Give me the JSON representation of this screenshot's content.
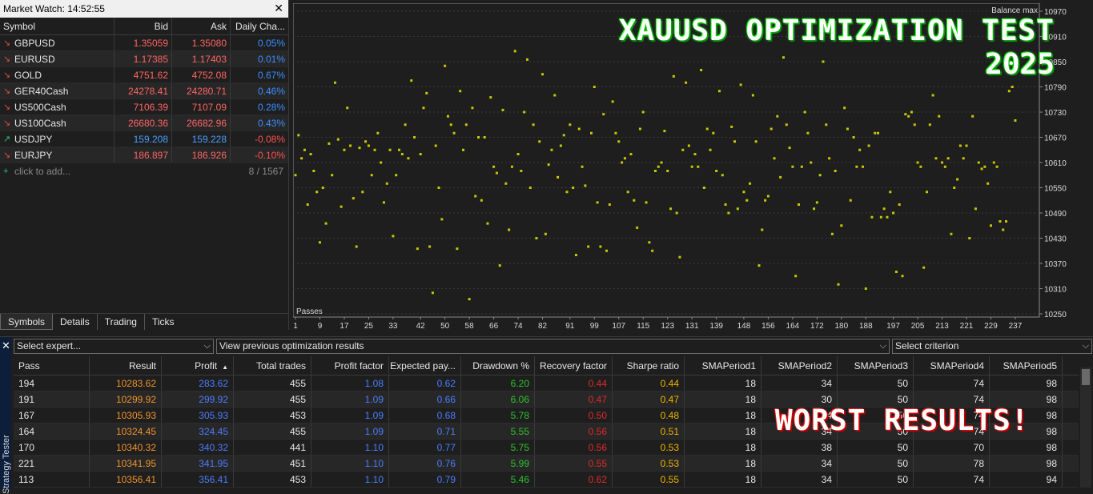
{
  "market_watch": {
    "title": "Market Watch: 14:52:55",
    "columns": [
      "Symbol",
      "Bid",
      "Ask",
      "Daily Cha..."
    ],
    "rows": [
      {
        "symbol": "GBPUSD",
        "bid": "1.35059",
        "ask": "1.35080",
        "change": "0.05%",
        "dir": "down",
        "change_sign": "pos"
      },
      {
        "symbol": "EURUSD",
        "bid": "1.17385",
        "ask": "1.17403",
        "change": "0.01%",
        "dir": "down",
        "change_sign": "pos"
      },
      {
        "symbol": "GOLD",
        "bid": "4751.62",
        "ask": "4752.08",
        "change": "0.67%",
        "dir": "down",
        "change_sign": "pos"
      },
      {
        "symbol": "GER40Cash",
        "bid": "24278.41",
        "ask": "24280.71",
        "change": "0.46%",
        "dir": "down",
        "change_sign": "pos"
      },
      {
        "symbol": "US500Cash",
        "bid": "7106.39",
        "ask": "7107.09",
        "change": "0.28%",
        "dir": "down",
        "change_sign": "pos"
      },
      {
        "symbol": "US100Cash",
        "bid": "26680.36",
        "ask": "26682.96",
        "change": "0.43%",
        "dir": "down",
        "change_sign": "pos"
      },
      {
        "symbol": "USDJPY",
        "bid": "159.208",
        "ask": "159.228",
        "change": "-0.08%",
        "dir": "up",
        "change_sign": "neg"
      },
      {
        "symbol": "EURJPY",
        "bid": "186.897",
        "ask": "186.926",
        "change": "-0.10%",
        "dir": "down",
        "change_sign": "neg"
      }
    ],
    "add_label": "click to add...",
    "count": "8 / 1567",
    "tabs": [
      "Symbols",
      "Details",
      "Trading",
      "Ticks"
    ]
  },
  "chart_data": {
    "type": "scatter",
    "title": "XAUUSD OPTIMIZATION TEST",
    "subtitle": "2025",
    "ylabel": "Balance max",
    "xlabel": "Passes",
    "ylim": [
      10250,
      10980
    ],
    "y_ticks": [
      "10970",
      "10910",
      "10850",
      "10790",
      "10730",
      "10670",
      "10610",
      "10550",
      "10490",
      "10430",
      "10370",
      "10310",
      "10250"
    ],
    "x_ticks": [
      "1",
      "9",
      "17",
      "25",
      "33",
      "42",
      "50",
      "58",
      "66",
      "74",
      "82",
      "91",
      "99",
      "107",
      "115",
      "123",
      "131",
      "139",
      "148",
      "156",
      "164",
      "172",
      "180",
      "188",
      "197",
      "205",
      "213",
      "221",
      "229",
      "237"
    ],
    "x_range": [
      1,
      242
    ],
    "points": [
      [
        1,
        10580
      ],
      [
        2,
        10675
      ],
      [
        3,
        10620
      ],
      [
        4,
        10640
      ],
      [
        5,
        10510
      ],
      [
        6,
        10630
      ],
      [
        7,
        10590
      ],
      [
        8,
        10540
      ],
      [
        9,
        10420
      ],
      [
        10,
        10550
      ],
      [
        11,
        10465
      ],
      [
        12,
        10655
      ],
      [
        13,
        10580
      ],
      [
        14,
        10800
      ],
      [
        15,
        10665
      ],
      [
        16,
        10505
      ],
      [
        17,
        10640
      ],
      [
        18,
        10740
      ],
      [
        19,
        10650
      ],
      [
        20,
        10525
      ],
      [
        21,
        10410
      ],
      [
        22,
        10645
      ],
      [
        23,
        10540
      ],
      [
        24,
        10660
      ],
      [
        25,
        10650
      ],
      [
        26,
        10580
      ],
      [
        27,
        10640
      ],
      [
        28,
        10680
      ],
      [
        29,
        10610
      ],
      [
        30,
        10515
      ],
      [
        31,
        10560
      ],
      [
        32,
        10640
      ],
      [
        33,
        10435
      ],
      [
        34,
        10580
      ],
      [
        35,
        10640
      ],
      [
        36,
        10630
      ],
      [
        37,
        10700
      ],
      [
        38,
        10620
      ],
      [
        39,
        10805
      ],
      [
        40,
        10670
      ],
      [
        41,
        10405
      ],
      [
        42,
        10630
      ],
      [
        43,
        10740
      ],
      [
        44,
        10775
      ],
      [
        45,
        10410
      ],
      [
        46,
        10300
      ],
      [
        47,
        10650
      ],
      [
        48,
        10550
      ],
      [
        49,
        10475
      ],
      [
        50,
        10840
      ],
      [
        51,
        10720
      ],
      [
        52,
        10700
      ],
      [
        53,
        10680
      ],
      [
        54,
        10405
      ],
      [
        55,
        10780
      ],
      [
        56,
        10640
      ],
      [
        57,
        10700
      ],
      [
        58,
        10285
      ],
      [
        59,
        10740
      ],
      [
        60,
        10530
      ],
      [
        61,
        10670
      ],
      [
        62,
        10520
      ],
      [
        63,
        10670
      ],
      [
        64,
        10465
      ],
      [
        65,
        10765
      ],
      [
        66,
        10600
      ],
      [
        67,
        10585
      ],
      [
        68,
        10365
      ],
      [
        69,
        10735
      ],
      [
        70,
        10560
      ],
      [
        71,
        10450
      ],
      [
        72,
        10600
      ],
      [
        73,
        10875
      ],
      [
        74,
        10630
      ],
      [
        75,
        10590
      ],
      [
        76,
        10730
      ],
      [
        77,
        10855
      ],
      [
        78,
        10550
      ],
      [
        79,
        10700
      ],
      [
        80,
        10430
      ],
      [
        81,
        10660
      ],
      [
        82,
        10820
      ],
      [
        83,
        10440
      ],
      [
        84,
        10605
      ],
      [
        85,
        10640
      ],
      [
        86,
        10770
      ],
      [
        87,
        10575
      ],
      [
        88,
        10650
      ],
      [
        89,
        10675
      ],
      [
        90,
        10540
      ],
      [
        91,
        10700
      ],
      [
        92,
        10550
      ],
      [
        93,
        10390
      ],
      [
        94,
        10690
      ],
      [
        95,
        10600
      ],
      [
        96,
        10555
      ],
      [
        97,
        10410
      ],
      [
        98,
        10680
      ],
      [
        99,
        10790
      ],
      [
        100,
        10515
      ],
      [
        101,
        10410
      ],
      [
        102,
        10725
      ],
      [
        103,
        10400
      ],
      [
        104,
        10510
      ],
      [
        105,
        10755
      ],
      [
        106,
        10680
      ],
      [
        107,
        10660
      ],
      [
        108,
        10610
      ],
      [
        109,
        10620
      ],
      [
        110,
        10540
      ],
      [
        111,
        10630
      ],
      [
        112,
        10520
      ],
      [
        113,
        10455
      ],
      [
        114,
        10690
      ],
      [
        115,
        10730
      ],
      [
        116,
        10515
      ],
      [
        117,
        10420
      ],
      [
        118,
        10400
      ],
      [
        119,
        10590
      ],
      [
        120,
        10600
      ],
      [
        121,
        10610
      ],
      [
        122,
        10685
      ],
      [
        123,
        10590
      ],
      [
        124,
        10500
      ],
      [
        125,
        10815
      ],
      [
        126,
        10490
      ],
      [
        127,
        10385
      ],
      [
        128,
        10640
      ],
      [
        129,
        10800
      ],
      [
        130,
        10650
      ],
      [
        131,
        10600
      ],
      [
        132,
        10630
      ],
      [
        133,
        10600
      ],
      [
        134,
        10830
      ],
      [
        135,
        10550
      ],
      [
        136,
        10690
      ],
      [
        137,
        10640
      ],
      [
        138,
        10680
      ],
      [
        139,
        10590
      ],
      [
        140,
        10780
      ],
      [
        141,
        10580
      ],
      [
        142,
        10510
      ],
      [
        143,
        10490
      ],
      [
        144,
        10695
      ],
      [
        145,
        10660
      ],
      [
        146,
        10500
      ],
      [
        147,
        10795
      ],
      [
        148,
        10540
      ],
      [
        149,
        10520
      ],
      [
        150,
        10560
      ],
      [
        151,
        10770
      ],
      [
        152,
        10660
      ],
      [
        153,
        10365
      ],
      [
        154,
        10450
      ],
      [
        155,
        10520
      ],
      [
        156,
        10530
      ],
      [
        157,
        10690
      ],
      [
        158,
        10620
      ],
      [
        159,
        10720
      ],
      [
        160,
        10575
      ],
      [
        161,
        10860
      ],
      [
        162,
        10700
      ],
      [
        163,
        10645
      ],
      [
        164,
        10600
      ],
      [
        165,
        10340
      ],
      [
        166,
        10510
      ],
      [
        167,
        10600
      ],
      [
        168,
        10730
      ],
      [
        169,
        10680
      ],
      [
        170,
        10610
      ],
      [
        171,
        10500
      ],
      [
        172,
        10515
      ],
      [
        173,
        10580
      ],
      [
        174,
        10850
      ],
      [
        175,
        10700
      ],
      [
        176,
        10620
      ],
      [
        177,
        10440
      ],
      [
        178,
        10590
      ],
      [
        179,
        10320
      ],
      [
        180,
        10460
      ],
      [
        181,
        10740
      ],
      [
        182,
        10690
      ],
      [
        183,
        10520
      ],
      [
        184,
        10670
      ],
      [
        185,
        10600
      ],
      [
        186,
        10640
      ],
      [
        187,
        10600
      ],
      [
        188,
        10310
      ],
      [
        189,
        10650
      ],
      [
        190,
        10480
      ],
      [
        191,
        10680
      ],
      [
        192,
        10680
      ],
      [
        193,
        10480
      ],
      [
        194,
        10500
      ],
      [
        195,
        10480
      ],
      [
        196,
        10540
      ],
      [
        197,
        10490
      ],
      [
        198,
        10350
      ],
      [
        199,
        10510
      ],
      [
        200,
        10340
      ],
      [
        201,
        10725
      ],
      [
        202,
        10720
      ],
      [
        203,
        10730
      ],
      [
        204,
        10700
      ],
      [
        205,
        10610
      ],
      [
        206,
        10600
      ],
      [
        207,
        10360
      ],
      [
        208,
        10540
      ],
      [
        209,
        10700
      ],
      [
        210,
        10770
      ],
      [
        211,
        10620
      ],
      [
        212,
        10720
      ],
      [
        213,
        10610
      ],
      [
        214,
        10600
      ],
      [
        215,
        10620
      ],
      [
        216,
        10440
      ],
      [
        217,
        10550
      ],
      [
        218,
        10570
      ],
      [
        219,
        10650
      ],
      [
        220,
        10620
      ],
      [
        221,
        10650
      ],
      [
        222,
        10430
      ],
      [
        223,
        10720
      ],
      [
        224,
        10500
      ],
      [
        225,
        10610
      ],
      [
        226,
        10595
      ],
      [
        227,
        10600
      ],
      [
        228,
        10560
      ],
      [
        229,
        10460
      ],
      [
        230,
        10610
      ],
      [
        231,
        10600
      ],
      [
        232,
        10470
      ],
      [
        233,
        10450
      ],
      [
        234,
        10470
      ],
      [
        235,
        10780
      ],
      [
        236,
        10790
      ],
      [
        237,
        10710
      ]
    ],
    "point_color": "#c8c800"
  },
  "tester": {
    "side_label": "Strategy Tester",
    "select_expert": "Select expert...",
    "prev_results": "View previous optimization results",
    "select_criterion": "Select criterion",
    "columns": [
      "Pass",
      "Result",
      "Profit",
      "Total trades",
      "Profit factor",
      "Expected pay...",
      "Drawdown %",
      "Recovery factor",
      "Sharpe ratio",
      "SMAPeriod1",
      "SMAPeriod2",
      "SMAPeriod3",
      "SMAPeriod4",
      "SMAPeriod5"
    ],
    "sort_indicator": "▲",
    "rows": [
      [
        "194",
        "10283.62",
        "283.62",
        "455",
        "1.08",
        "0.62",
        "6.20",
        "0.44",
        "0.44",
        "18",
        "34",
        "50",
        "74",
        "98"
      ],
      [
        "191",
        "10299.92",
        "299.92",
        "455",
        "1.09",
        "0.66",
        "6.06",
        "0.47",
        "0.47",
        "18",
        "30",
        "50",
        "74",
        "98"
      ],
      [
        "167",
        "10305.93",
        "305.93",
        "453",
        "1.09",
        "0.68",
        "5.78",
        "0.50",
        "0.48",
        "18",
        "34",
        "50",
        "74",
        "98"
      ],
      [
        "164",
        "10324.45",
        "324.45",
        "455",
        "1.09",
        "0.71",
        "5.55",
        "0.56",
        "0.51",
        "18",
        "34",
        "50",
        "74",
        "98"
      ],
      [
        "170",
        "10340.32",
        "340.32",
        "441",
        "1.10",
        "0.77",
        "5.75",
        "0.56",
        "0.53",
        "18",
        "38",
        "50",
        "70",
        "98"
      ],
      [
        "221",
        "10341.95",
        "341.95",
        "451",
        "1.10",
        "0.76",
        "5.99",
        "0.55",
        "0.53",
        "18",
        "34",
        "50",
        "78",
        "98"
      ],
      [
        "113",
        "10356.41",
        "356.41",
        "453",
        "1.10",
        "0.79",
        "5.46",
        "0.62",
        "0.55",
        "18",
        "34",
        "50",
        "74",
        "94"
      ]
    ],
    "overlay_text": "WORST RESULTS!"
  }
}
